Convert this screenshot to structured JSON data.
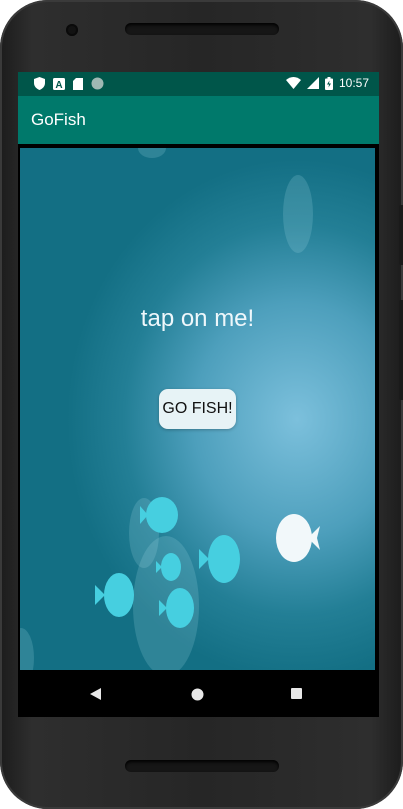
{
  "status_bar": {
    "time": "10:57",
    "icons": [
      "shield-icon",
      "a-icon",
      "sd-card-icon",
      "circle-icon",
      "wifi-icon",
      "cell-signal-icon",
      "battery-icon"
    ]
  },
  "app_bar": {
    "title": "GoFish"
  },
  "main": {
    "tap_label": "tap on me!",
    "button_label": "GO FISH!"
  },
  "nav_bar": {
    "icons": [
      "back-icon",
      "home-icon",
      "recents-icon"
    ]
  },
  "colors": {
    "status_bar": "#00564a",
    "app_bar": "#00796b",
    "fish_cyan": "#46cfe0",
    "fish_white": "#f2f8fa"
  }
}
